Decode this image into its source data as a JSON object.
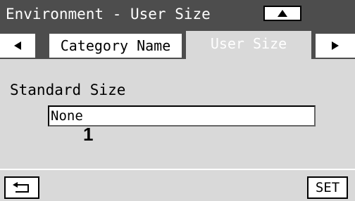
{
  "header": {
    "title": "Environment - User Size",
    "scroll_up_icon": "triangle-up-icon"
  },
  "tabs": {
    "prev_icon": "triangle-left-icon",
    "next_icon": "triangle-right-icon",
    "items": [
      {
        "label": "Category Name",
        "active": false
      },
      {
        "label": "User Size",
        "active": true
      }
    ]
  },
  "main": {
    "section_label": "Standard Size",
    "standard_size_value": "None",
    "callout_number": "1"
  },
  "footer": {
    "back_icon": "return-arrow-icon",
    "set_label": "SET"
  },
  "colors": {
    "panel_background": "#d9d9d9",
    "title_background": "#4d4d4d",
    "button_background": "#ffffff"
  }
}
